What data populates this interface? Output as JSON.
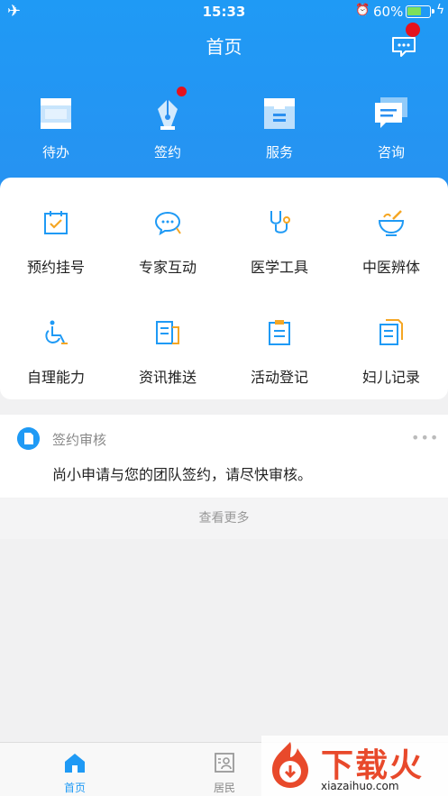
{
  "status_bar": {
    "time": "15:33",
    "battery": "60%"
  },
  "header": {
    "title": "首页"
  },
  "top_nav": [
    {
      "label": "待办",
      "icon": "todo-icon"
    },
    {
      "label": "签约",
      "icon": "pen-icon"
    },
    {
      "label": "服务",
      "icon": "inbox-icon"
    },
    {
      "label": "咨询",
      "icon": "chat-icon"
    }
  ],
  "grid": [
    {
      "label": "预约挂号",
      "icon": "calendar-check-icon"
    },
    {
      "label": "专家互动",
      "icon": "chat-bubble-icon"
    },
    {
      "label": "医学工具",
      "icon": "stethoscope-icon"
    },
    {
      "label": "中医辨体",
      "icon": "mortar-icon"
    },
    {
      "label": "自理能力",
      "icon": "wheelchair-icon"
    },
    {
      "label": "资讯推送",
      "icon": "news-icon"
    },
    {
      "label": "活动登记",
      "icon": "clipboard-icon"
    },
    {
      "label": "妇儿记录",
      "icon": "document-icon"
    }
  ],
  "notice": {
    "title": "签约审核",
    "body": "尚小申请与您的团队签约，请尽快审核。",
    "more": "•••"
  },
  "view_more": "查看更多",
  "tabbar": [
    {
      "label": "首页",
      "active": true
    },
    {
      "label": "居民",
      "active": false
    }
  ],
  "watermark": {
    "brand": "下载火",
    "url": "xiazaihuo.com"
  },
  "colors": {
    "primary": "#1f9af5",
    "accent": "#f5a623",
    "badge": "#e5121d"
  }
}
